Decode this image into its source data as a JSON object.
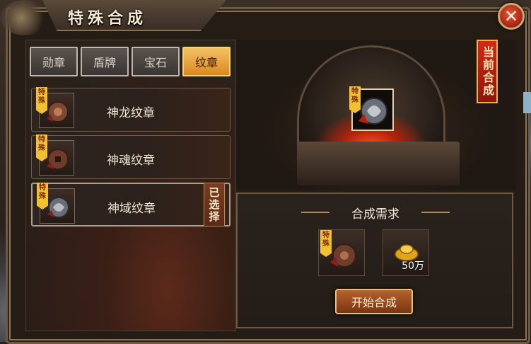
{
  "window": {
    "title": "特殊合成",
    "close_label": "✕"
  },
  "tabs": [
    {
      "label": "勋章",
      "active": false
    },
    {
      "label": "盾牌",
      "active": false
    },
    {
      "label": "宝石",
      "active": false
    },
    {
      "label": "纹章",
      "active": true
    }
  ],
  "items": [
    {
      "name": "神龙纹章",
      "badge": "特殊",
      "selected": false
    },
    {
      "name": "神魂纹章",
      "badge": "特殊",
      "selected": false
    },
    {
      "name": "神域纹章",
      "badge": "特殊",
      "selected": true,
      "selected_label": "已选择"
    }
  ],
  "current": {
    "label": "当前合成",
    "badge": "特殊"
  },
  "requirements": {
    "title": "合成需求",
    "material_badge": "特殊",
    "gold_amount": "50万"
  },
  "start_button": "开始合成",
  "colors": {
    "active_tab": "#d9891f",
    "badge": "#f3c12f",
    "current_tag": "#d02a18",
    "start_button": "#b7612e"
  }
}
